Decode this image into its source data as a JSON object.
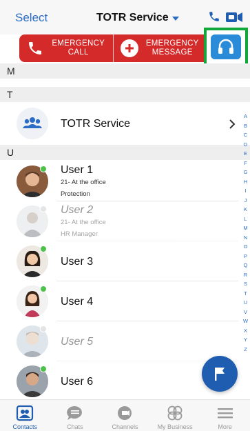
{
  "header": {
    "select_label": "Select",
    "title": "TOTR Service"
  },
  "emergency": {
    "call_line1": "EMERGENCY",
    "call_line2": "CALL",
    "message_line1": "EMERGENCY",
    "message_line2": "MESSAGE"
  },
  "sections": [
    "M",
    "T",
    "U"
  ],
  "service_row": {
    "name": "TOTR Service"
  },
  "users": [
    {
      "name": "User 1",
      "status_line": "21- At the office",
      "role": "Protection",
      "status": "online",
      "dimmed": false
    },
    {
      "name": "User 2",
      "status_line": "21- At the office",
      "role": "HR Manager",
      "status": "offline",
      "dimmed": true
    },
    {
      "name": "User 3",
      "status_line": "",
      "role": "",
      "status": "online",
      "dimmed": false
    },
    {
      "name": "User 4",
      "status_line": "",
      "role": "",
      "status": "online",
      "dimmed": false
    },
    {
      "name": "User 5",
      "status_line": "",
      "role": "",
      "status": "offline",
      "dimmed": true
    },
    {
      "name": "User 6",
      "status_line": "",
      "role": "",
      "status": "online",
      "dimmed": false
    }
  ],
  "index_letters": [
    "A",
    "B",
    "C",
    "D",
    "E",
    "F",
    "G",
    "H",
    "I",
    "J",
    "K",
    "L",
    "M",
    "N",
    "O",
    "P",
    "Q",
    "R",
    "S",
    "T",
    "U",
    "V",
    "W",
    "X",
    "Y",
    "Z"
  ],
  "tabs": [
    {
      "label": "Contacts",
      "icon": "contacts-icon",
      "active": true
    },
    {
      "label": "Chats",
      "icon": "chats-icon",
      "active": false
    },
    {
      "label": "Channels",
      "icon": "channels-icon",
      "active": false
    },
    {
      "label": "My Business",
      "icon": "my-business-icon",
      "active": false
    },
    {
      "label": "More",
      "icon": "more-icon",
      "active": false
    }
  ],
  "colors": {
    "accent": "#2b6cc4",
    "emergency_red": "#d42a2a",
    "headset_blue": "#2a8bd8",
    "highlight_green": "#12a73b",
    "online_green": "#4cc24a",
    "offline_gray": "#c4c4c4",
    "fab_blue": "#1e5db0"
  }
}
